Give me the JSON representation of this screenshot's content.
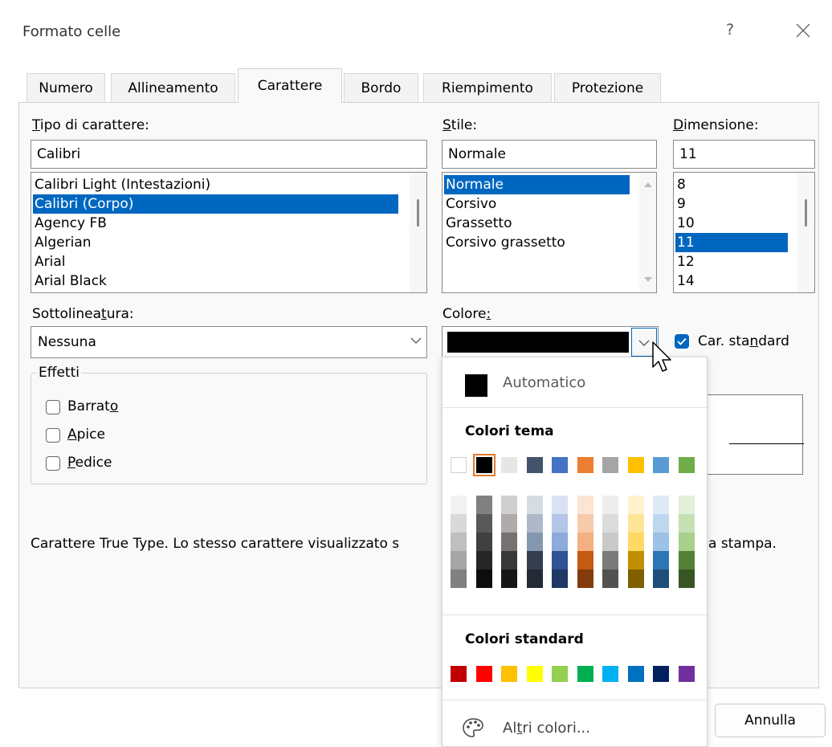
{
  "window": {
    "title": "Formato celle",
    "help": "?"
  },
  "tabs": [
    "Numero",
    "Allineamento",
    "Carattere",
    "Bordo",
    "Riempimento",
    "Protezione"
  ],
  "font": {
    "label_u": "T",
    "label_rest": "ipo di carattere:",
    "value": "Calibri",
    "items": [
      "Calibri Light (Intestazioni)",
      "Calibri (Corpo)",
      "Agency FB",
      "Algerian",
      "Arial",
      "Arial Black"
    ],
    "selected_index": 1
  },
  "style": {
    "label_u": "S",
    "label_rest": "tile:",
    "value": "Normale",
    "items": [
      "Normale",
      "Corsivo",
      "Grassetto",
      "Corsivo grassetto"
    ],
    "selected_index": 0
  },
  "size": {
    "label_u": "D",
    "label_rest": "imensione:",
    "value": "11",
    "items": [
      "8",
      "9",
      "10",
      "11",
      "12",
      "14"
    ],
    "selected_index": 3
  },
  "underline": {
    "label_a": "Sottolinea",
    "label_u": "t",
    "label_b": "ura:",
    "value": "Nessuna"
  },
  "color": {
    "label_a": "Colore",
    "label_u": ":",
    "current": "#000000",
    "normal_font_pre": "Car. sta",
    "normal_font_u": "n",
    "normal_font_post": "dard",
    "normal_font_checked": true
  },
  "effects": {
    "title": "Effetti",
    "strike": {
      "pre": "Barrat",
      "u": "o",
      "post": ""
    },
    "super": {
      "u": "A",
      "post": "pice"
    },
    "sub": {
      "u": "P",
      "post": "edice"
    }
  },
  "description_left": "Carattere True Type. Lo stesso carattere visualizzato s",
  "description_right": "a stampa.",
  "buttons": {
    "cancel": "Annulla"
  },
  "palette": {
    "automatic": "Automatico",
    "theme_title": "Colori tema",
    "standard_title": "Colori standard",
    "more_pre": "Al",
    "more_u": "t",
    "more_post": "ri colori...",
    "theme_top": [
      "#FFFFFF",
      "#000000",
      "#E7E6E6",
      "#44546A",
      "#4472C4",
      "#ED7D31",
      "#A5A5A5",
      "#FFC000",
      "#5B9BD5",
      "#70AD47"
    ],
    "theme_selected": 1,
    "theme_shades": [
      [
        "#F2F2F2",
        "#D9D9D9",
        "#BFBFBF",
        "#A6A6A6",
        "#808080"
      ],
      [
        "#808080",
        "#595959",
        "#404040",
        "#262626",
        "#0D0D0D"
      ],
      [
        "#D0CECE",
        "#AEAAAA",
        "#767171",
        "#3A3838",
        "#171616"
      ],
      [
        "#D6DCE4",
        "#ADB9CA",
        "#8497B0",
        "#333F4F",
        "#222A35"
      ],
      [
        "#D9E2F3",
        "#B4C6E7",
        "#8EAADB",
        "#2F5496",
        "#1F3864"
      ],
      [
        "#FBE5D5",
        "#F7CAAC",
        "#F4B083",
        "#C55A11",
        "#833C0B"
      ],
      [
        "#EDEDED",
        "#DBDBDB",
        "#C9C9C9",
        "#7B7B7B",
        "#525252"
      ],
      [
        "#FFF2CC",
        "#FFE598",
        "#FFD965",
        "#BF8F00",
        "#7F5F00"
      ],
      [
        "#DEEBF6",
        "#BDD7EE",
        "#9CC3E5",
        "#2E75B5",
        "#1E4E79"
      ],
      [
        "#E2EFD9",
        "#C5E0B3",
        "#A8D08D",
        "#538135",
        "#375623"
      ]
    ],
    "standard": [
      "#C00000",
      "#FF0000",
      "#FFC000",
      "#FFFF00",
      "#92D050",
      "#00B050",
      "#00B0F0",
      "#0070C0",
      "#002060",
      "#7030A0"
    ]
  }
}
